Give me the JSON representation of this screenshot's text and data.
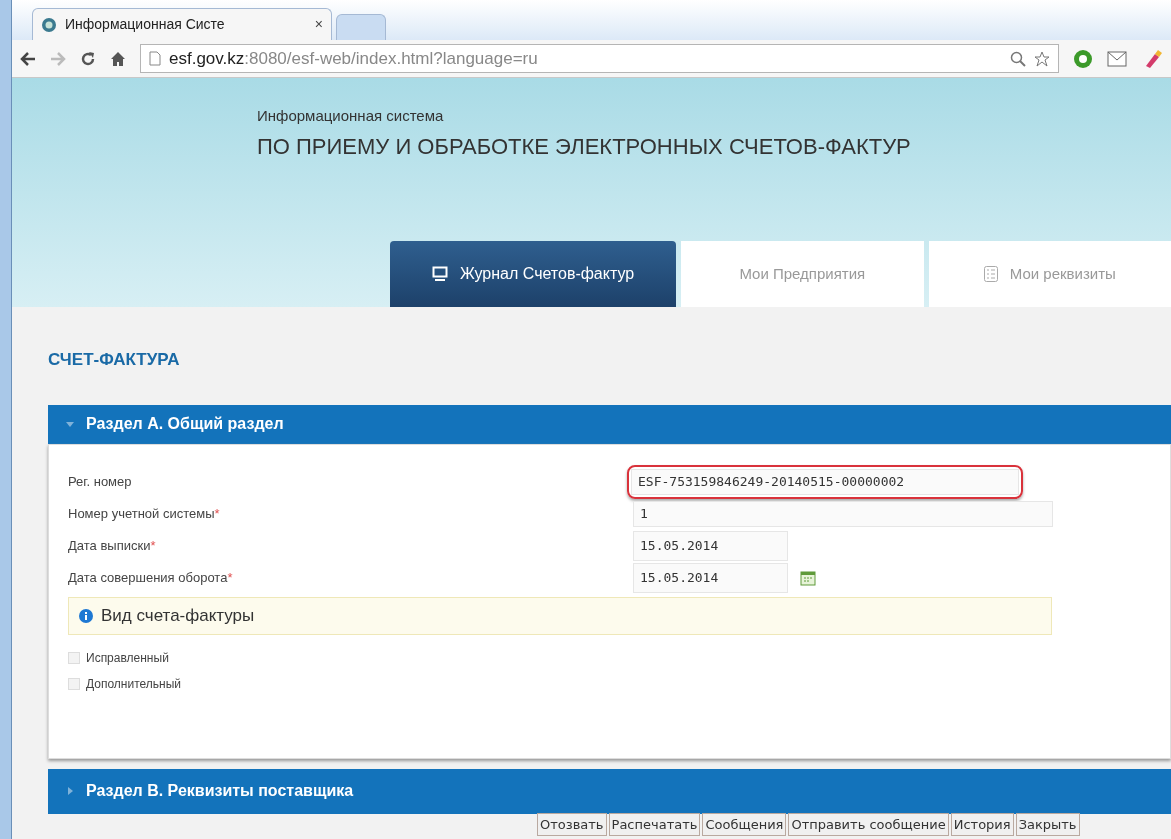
{
  "browser": {
    "tab_title": "Информационная Систе",
    "tab_close": "×",
    "address_host": "esf.gov.kz",
    "address_rest": ":8080/esf-web/index.html?language=ru"
  },
  "header": {
    "subtitle": "Информационная система",
    "title": "ПО ПРИЕМУ И ОБРАБОТКЕ ЭЛЕКТРОННЫХ СЧЕТОВ-ФАКТУР"
  },
  "nav_tabs": [
    {
      "label": "Журнал Счетов-фактур",
      "selected": true
    },
    {
      "label": "Мои Предприятия",
      "selected": false
    },
    {
      "label": "Мои реквизиты",
      "selected": false
    }
  ],
  "page_title": "СЧЕТ-ФАКТУРА",
  "section_a": {
    "title": "Раздел А. Общий раздел",
    "expanded": true,
    "fields": [
      {
        "label": "Рег. номер",
        "value": "ESF-753159846249-20140515-00000002",
        "highlighted": true,
        "kind": "wide"
      },
      {
        "label": "Номер учетной системы",
        "required_mark": "*",
        "value": "1",
        "highlighted": false,
        "kind": "wide"
      },
      {
        "label": "Дата выписки",
        "required_mark": "*",
        "value": "15.05.2014",
        "highlighted": false,
        "kind": "date"
      },
      {
        "label": "Дата совершения оборота",
        "required_mark": "*",
        "value": "15.05.2014",
        "highlighted": false,
        "kind": "date_picker"
      }
    ],
    "info": "Вид счета-фактуры",
    "checkboxes": [
      {
        "label": "Исправленный",
        "checked": false
      },
      {
        "label": "Дополнительный",
        "checked": false
      }
    ]
  },
  "section_b": {
    "title": "Раздел В. Реквизиты поставщика",
    "expanded": false
  },
  "actions": [
    "Отозвать",
    "Распечатать",
    "Сообщения",
    "Отправить сообщение",
    "История",
    "Закрыть"
  ]
}
